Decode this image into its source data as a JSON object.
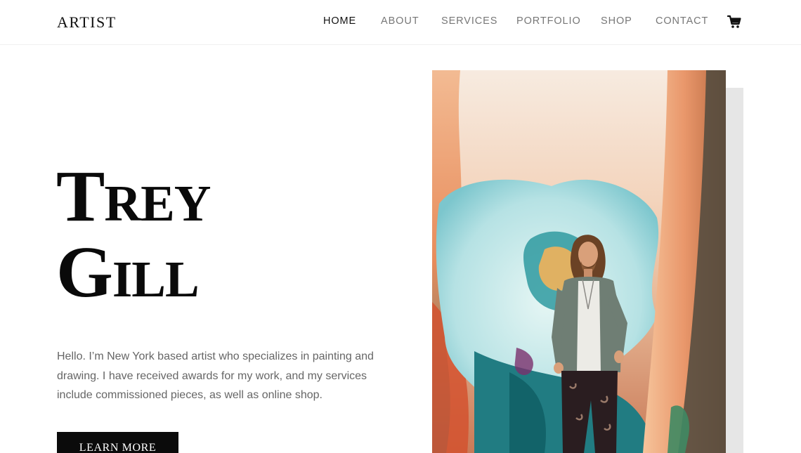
{
  "header": {
    "logo": "ARTIST",
    "nav": [
      {
        "label": "HOME",
        "active": true
      },
      {
        "label": "ABOUT",
        "active": false
      },
      {
        "label": "SERVICES",
        "active": false
      },
      {
        "label": "PORTFOLIO",
        "active": false
      },
      {
        "label": "SHOP",
        "active": false
      },
      {
        "label": "CONTACT",
        "active": false
      }
    ],
    "cart_icon": "cart-icon"
  },
  "hero": {
    "title_line1": "Trey",
    "title_line2": "Gill",
    "intro": "Hello. I’m New York based artist who specializes in painting and drawing. I have received awards for my work, and my services include commissioned pieces, as well as online shop.",
    "cta_label": "LEARN MORE"
  },
  "colors": {
    "accent": "#0b0b0b",
    "nav_inactive": "#777777",
    "shadow_panel": "#e6e6e6"
  }
}
